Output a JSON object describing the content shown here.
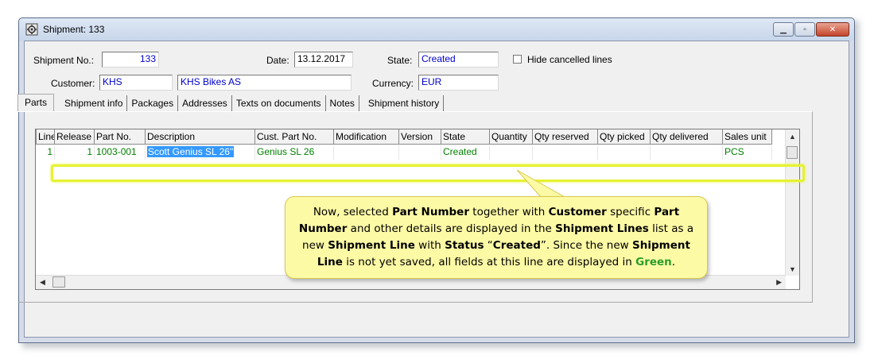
{
  "window": {
    "title": "Shipment: 133"
  },
  "header": {
    "shipment_no_label": "Shipment No.:",
    "shipment_no": "133",
    "date_label": "Date:",
    "date": "13.12.2017",
    "state_label": "State:",
    "state": "Created",
    "hide_cancelled_label": "Hide cancelled lines",
    "customer_label": "Customer:",
    "customer_code": "KHS",
    "customer_name": "KHS Bikes AS",
    "currency_label": "Currency:",
    "currency": "EUR"
  },
  "tabs": [
    "Parts",
    "Shipment info",
    "Packages",
    "Addresses",
    "Texts on documents",
    "Notes",
    "Shipment history"
  ],
  "grid": {
    "columns": [
      "Line",
      "Release",
      "Part No.",
      "Description",
      "Cust. Part No.",
      "Modification",
      "Version",
      "State",
      "Quantity",
      "Qty reserved",
      "Qty picked",
      "Qty delivered",
      "Sales unit"
    ],
    "rows": [
      {
        "line": "1",
        "release": "1",
        "part_no": "1003-001",
        "description": "Scott Genius SL 26\"",
        "cust_part_no": "Genius SL 26",
        "modification": "",
        "version": "",
        "state": "Created",
        "quantity": "",
        "qty_reserved": "",
        "qty_picked": "",
        "qty_delivered": "",
        "sales_unit": "PCS"
      }
    ]
  },
  "callout": {
    "t1": "Now, selected ",
    "b1": "Part Number",
    "t2": " together with ",
    "b2": "Customer",
    "t3": " specific ",
    "b3": "Part Number",
    "t4": " and other details are displayed in the ",
    "b4": "Shipment Lines",
    "t5": " list as a new ",
    "b5": "Shipment Line",
    "t6": " with ",
    "b6": "Status",
    "t7": " “",
    "b7": "Created",
    "t8": "”.  Since the new ",
    "b8": "Shipment Line",
    "t9": " is not yet saved, all fields at this line are displayed in ",
    "g1": "Green",
    "t10": "."
  },
  "colors": {
    "highlight": "#e5f231",
    "callout_bg": "#fdfaa6",
    "new_line_text": "#008000",
    "green_word": "#2a9d2a"
  }
}
